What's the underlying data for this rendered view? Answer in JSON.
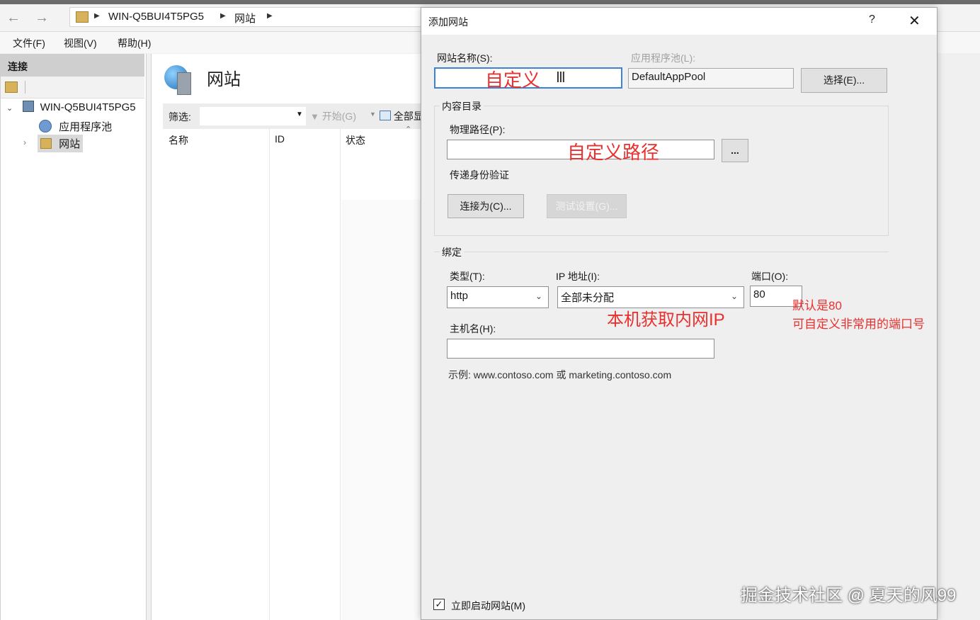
{
  "address_bar": {
    "crumbs": [
      "WIN-Q5BUI4T5PG5",
      "网站"
    ]
  },
  "menu": {
    "items": [
      "文件(F)",
      "视图(V)",
      "帮助(H)"
    ]
  },
  "connections": {
    "header": "连接",
    "tree": {
      "server": "WIN-Q5BUI4T5PG5",
      "app_pools": "应用程序池",
      "sites": "网站"
    }
  },
  "center": {
    "title": "网站",
    "filter_label": "筛选:",
    "start_label": "开始(G)",
    "show_all_label": "全部显",
    "columns": [
      "名称",
      "ID",
      "状态"
    ]
  },
  "dialog": {
    "title": "添加网站",
    "help": "?",
    "close": "✕",
    "site_name_label": "网站名称(S):",
    "site_name_value": "",
    "app_pool_label": "应用程序池(L):",
    "app_pool_value": "DefaultAppPool",
    "select_button": "选择(E)...",
    "content_group": "内容目录",
    "physical_path_label": "物理路径(P):",
    "physical_path_value": "",
    "browse_button": "...",
    "pass_auth_label": "传递身份验证",
    "connect_as_button": "连接为(C)...",
    "test_settings_button": "测试设置(G)...",
    "binding_group": "绑定",
    "type_label": "类型(T):",
    "type_value": "http",
    "ip_label": "IP 地址(I):",
    "ip_value": "全部未分配",
    "port_label": "端口(O):",
    "port_value": "80",
    "hostname_label": "主机名(H):",
    "hostname_value": "",
    "example_text": "示例: www.contoso.com 或 marketing.contoso.com",
    "start_site_label": "立即启动网站(M)",
    "start_site_checked": true
  },
  "annotations": {
    "custom": "自定义",
    "custom_path": "自定义路径",
    "local_ip": "本机获取内网IP",
    "port_note_1": "默认是80",
    "port_note_2": "可自定义非常用的端口号",
    "color": "#e8312f"
  },
  "watermark": "掘金技术社区 @ 夏天的风99"
}
